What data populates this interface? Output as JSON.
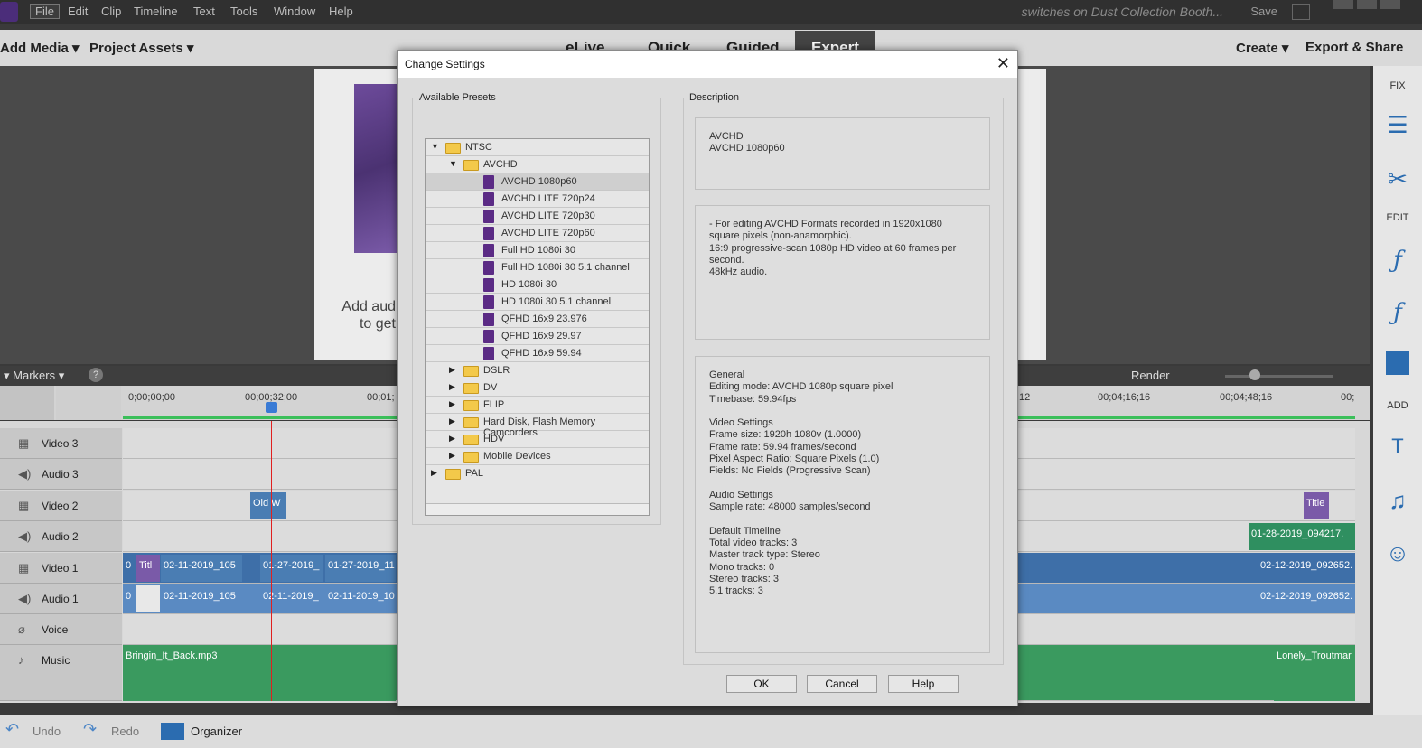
{
  "menubar": {
    "items": [
      "File",
      "Edit",
      "Clip",
      "Timeline",
      "Text",
      "Tools",
      "Window",
      "Help"
    ],
    "document_title": "switches on Dust Collection Booth...",
    "save_label": "Save"
  },
  "toolbar": {
    "add_media": "Add Media",
    "project_assets": "Project Assets",
    "modes": [
      "eLive",
      "Quick",
      "Guided",
      "Expert"
    ],
    "create": "Create",
    "export_share": "Export & Share"
  },
  "preview": {
    "hint_line1": "Add aud",
    "hint_line2": "to get"
  },
  "right_panel": {
    "fix_label": "FIX",
    "edit_label": "EDIT",
    "add_label": "ADD"
  },
  "timeline": {
    "markers_label": "Markers",
    "render_label": "Render",
    "timecodes_left": [
      "0;00;00;00",
      "00;00;32;00",
      "00;01;"
    ],
    "timecodes_right": [
      "12",
      "00;04;16;16",
      "00;04;48;16",
      "00;"
    ],
    "tracks": [
      "Video 3",
      "Audio 3",
      "Video 2",
      "Audio 2",
      "Video 1",
      "Audio 1",
      "Voice",
      "Music"
    ],
    "clips": {
      "old_w": "Old W",
      "title_v2": "Title",
      "audio2_right": "01-28-2019_094217.",
      "v1_0": "0",
      "v1_titl": "Titl",
      "v1_a": "02-11-2019_105",
      "v1_b": "01-27-2019_",
      "v1_c": "01-27-2019_11",
      "v1_right": "02-12-2019_092652.",
      "a1_0": "0",
      "a1_a": "02-11-2019_105",
      "a1_b": "02-11-2019_",
      "a1_c": "02-11-2019_10",
      "a1_right": "02-12-2019_092652.",
      "music_left": "Bringin_It_Back.mp3",
      "music_right": "Lonely_Troutmar"
    }
  },
  "bottombar": {
    "undo": "Undo",
    "redo": "Redo",
    "organizer": "Organizer"
  },
  "dialog": {
    "title": "Change Settings",
    "available_presets_label": "Available Presets",
    "description_label": "Description",
    "tree": [
      {
        "label": "NTSC",
        "level": 0,
        "type": "folder",
        "expanded": true
      },
      {
        "label": "AVCHD",
        "level": 1,
        "type": "folder",
        "expanded": true
      },
      {
        "label": "AVCHD 1080p60",
        "level": 2,
        "type": "preset",
        "selected": true
      },
      {
        "label": "AVCHD LITE 720p24",
        "level": 2,
        "type": "preset"
      },
      {
        "label": "AVCHD LITE 720p30",
        "level": 2,
        "type": "preset"
      },
      {
        "label": "AVCHD LITE 720p60",
        "level": 2,
        "type": "preset"
      },
      {
        "label": "Full HD 1080i 30",
        "level": 2,
        "type": "preset"
      },
      {
        "label": "Full HD 1080i 30 5.1 channel",
        "level": 2,
        "type": "preset"
      },
      {
        "label": "HD 1080i 30",
        "level": 2,
        "type": "preset"
      },
      {
        "label": "HD 1080i 30 5.1 channel",
        "level": 2,
        "type": "preset"
      },
      {
        "label": "QFHD 16x9 23.976",
        "level": 2,
        "type": "preset"
      },
      {
        "label": "QFHD 16x9 29.97",
        "level": 2,
        "type": "preset"
      },
      {
        "label": "QFHD 16x9 59.94",
        "level": 2,
        "type": "preset"
      },
      {
        "label": "DSLR",
        "level": 1,
        "type": "folder"
      },
      {
        "label": "DV",
        "level": 1,
        "type": "folder"
      },
      {
        "label": "FLIP",
        "level": 1,
        "type": "folder"
      },
      {
        "label": "Hard Disk, Flash Memory Camcorders",
        "level": 1,
        "type": "folder"
      },
      {
        "label": "HDV",
        "level": 1,
        "type": "folder"
      },
      {
        "label": "Mobile Devices",
        "level": 1,
        "type": "folder"
      },
      {
        "label": "PAL",
        "level": 0,
        "type": "folder"
      }
    ],
    "desc_name": "AVCHD\nAVCHD 1080p60",
    "desc_text": "- For editing AVCHD Formats recorded in 1920x1080\nsquare pixels (non-anamorphic).\n16:9 progressive-scan 1080p HD video at 60 frames per\nsecond.\n48kHz audio.",
    "desc_details": "General\n Editing mode: AVCHD 1080p square pixel\n Timebase: 59.94fps\n\nVideo Settings\n Frame size: 1920h 1080v (1.0000)\n Frame rate: 59.94 frames/second\n Pixel Aspect Ratio: Square Pixels (1.0)\n Fields: No Fields (Progressive Scan)\n\nAudio Settings\n Sample rate: 48000 samples/second\n\nDefault Timeline\n Total video tracks: 3\n Master track type: Stereo\n Mono tracks: 0\n Stereo tracks: 3\n 5.1 tracks: 3",
    "ok": "OK",
    "cancel": "Cancel",
    "help": "Help"
  }
}
